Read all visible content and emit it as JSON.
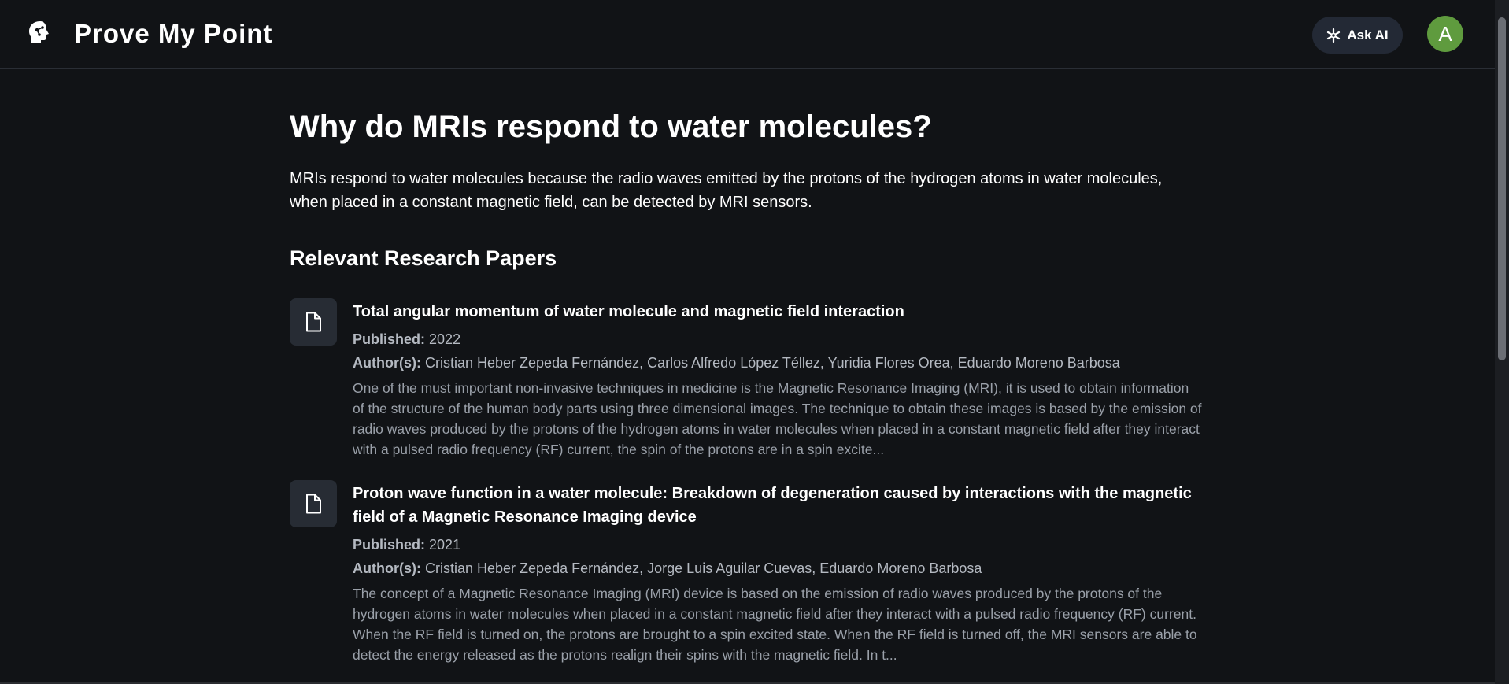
{
  "header": {
    "brand": "Prove My Point",
    "ask_ai_label": "Ask AI",
    "avatar_letter": "A",
    "logo_icon": "head-circuit-icon",
    "ask_ai_icon": "sparkle-icon"
  },
  "main": {
    "question": "Why do MRIs respond to water molecules?",
    "answer": "MRIs respond to water molecules because the radio waves emitted by the protons of the hydrogen atoms in water molecules, when placed in a constant magnetic field, can be detected by MRI sensors.",
    "section_title": "Relevant Research Papers",
    "published_label": "Published:",
    "authors_label": "Author(s):",
    "papers": [
      {
        "title": "Total angular momentum of water molecule and magnetic field interaction",
        "published": "2022",
        "authors": "Cristian Heber Zepeda Fernández, Carlos Alfredo López Téllez, Yuridia Flores Orea, Eduardo Moreno Barbosa",
        "abstract": "One of the must important non-invasive techniques in medicine is the Magnetic Resonance Imaging (MRI), it is used to obtain information of the structure of the human body parts using three dimensional images. The technique to obtain these images is based by the emission of radio waves produced by the protons of the hydrogen atoms in water molecules when placed in a constant magnetic field after they interact with a pulsed radio frequency (RF) current, the spin of the protons are in a spin excite..."
      },
      {
        "title": "Proton wave function in a water molecule: Breakdown of degeneration caused by interactions with the magnetic field of a Magnetic Resonance Imaging device",
        "published": "2021",
        "authors": "Cristian Heber Zepeda Fernández, Jorge Luis Aguilar Cuevas, Eduardo Moreno Barbosa",
        "abstract": "The concept of a Magnetic Resonance Imaging (MRI) device is based on the emission of radio waves produced by the protons of the hydrogen atoms in water molecules when placed in a constant magnetic field after they interact with a pulsed radio frequency (RF) current. When the RF field is turned on, the protons are brought to a spin excited state. When the RF field is turned off, the MRI sensors are able to detect the energy released as the protons realign their spins with the magnetic field. In t..."
      }
    ]
  },
  "colors": {
    "background": "#111316",
    "avatar": "#5f9b3e",
    "button": "#232935"
  }
}
